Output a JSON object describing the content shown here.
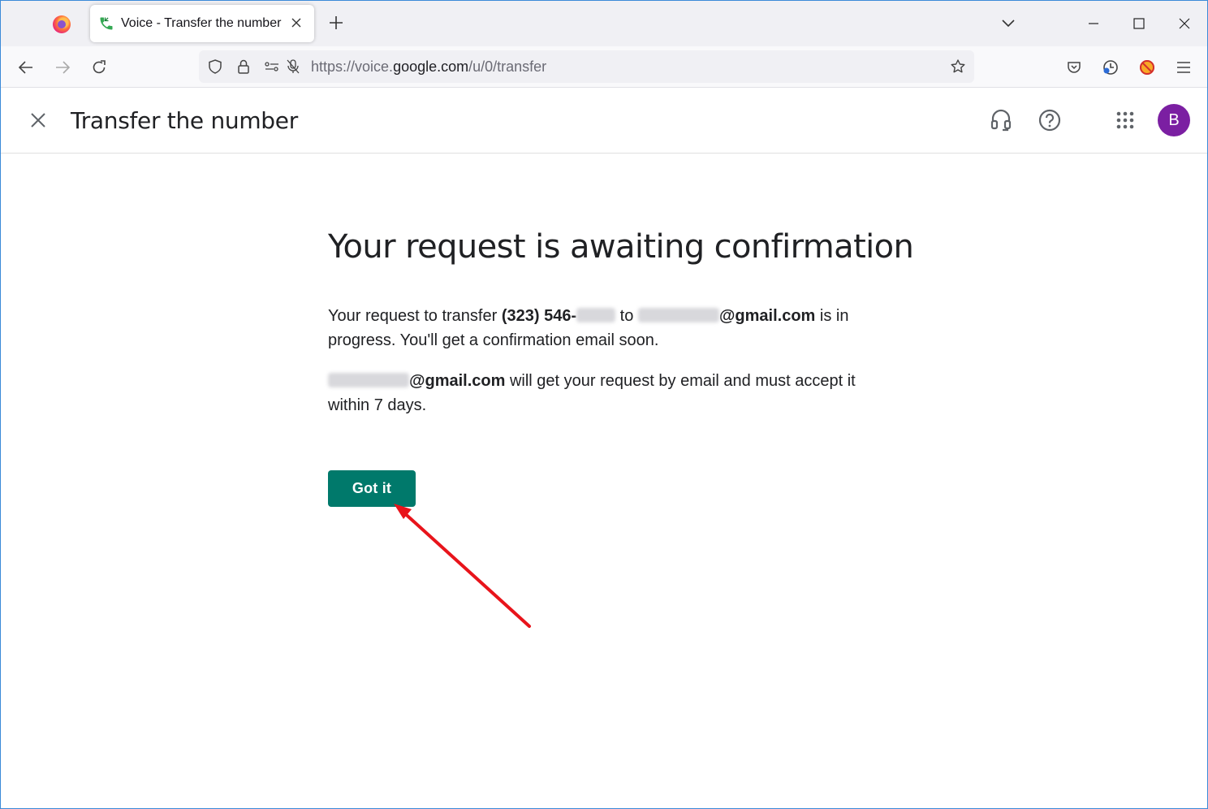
{
  "browser": {
    "tab_title": "Voice - Transfer the number",
    "url_prefix": "https://voice.",
    "url_domain": "google.com",
    "url_path": "/u/0/transfer"
  },
  "header": {
    "title": "Transfer the number",
    "avatar_letter": "B"
  },
  "main": {
    "heading": "Your request is awaiting confirmation",
    "para1": {
      "t1": "Your request to transfer ",
      "phone": "(323) 546-",
      "t2": " to ",
      "email_domain": "@gmail.com",
      "t3": " is in progress. You'll get a confirmation email soon."
    },
    "para2": {
      "email_domain": "@gmail.com",
      "t1": " will get your request by email and must accept it within 7 days."
    },
    "button_label": "Got it"
  },
  "colors": {
    "accent": "#00796b",
    "avatar": "#7b1fa2",
    "annotation_arrow": "#e8141b"
  }
}
